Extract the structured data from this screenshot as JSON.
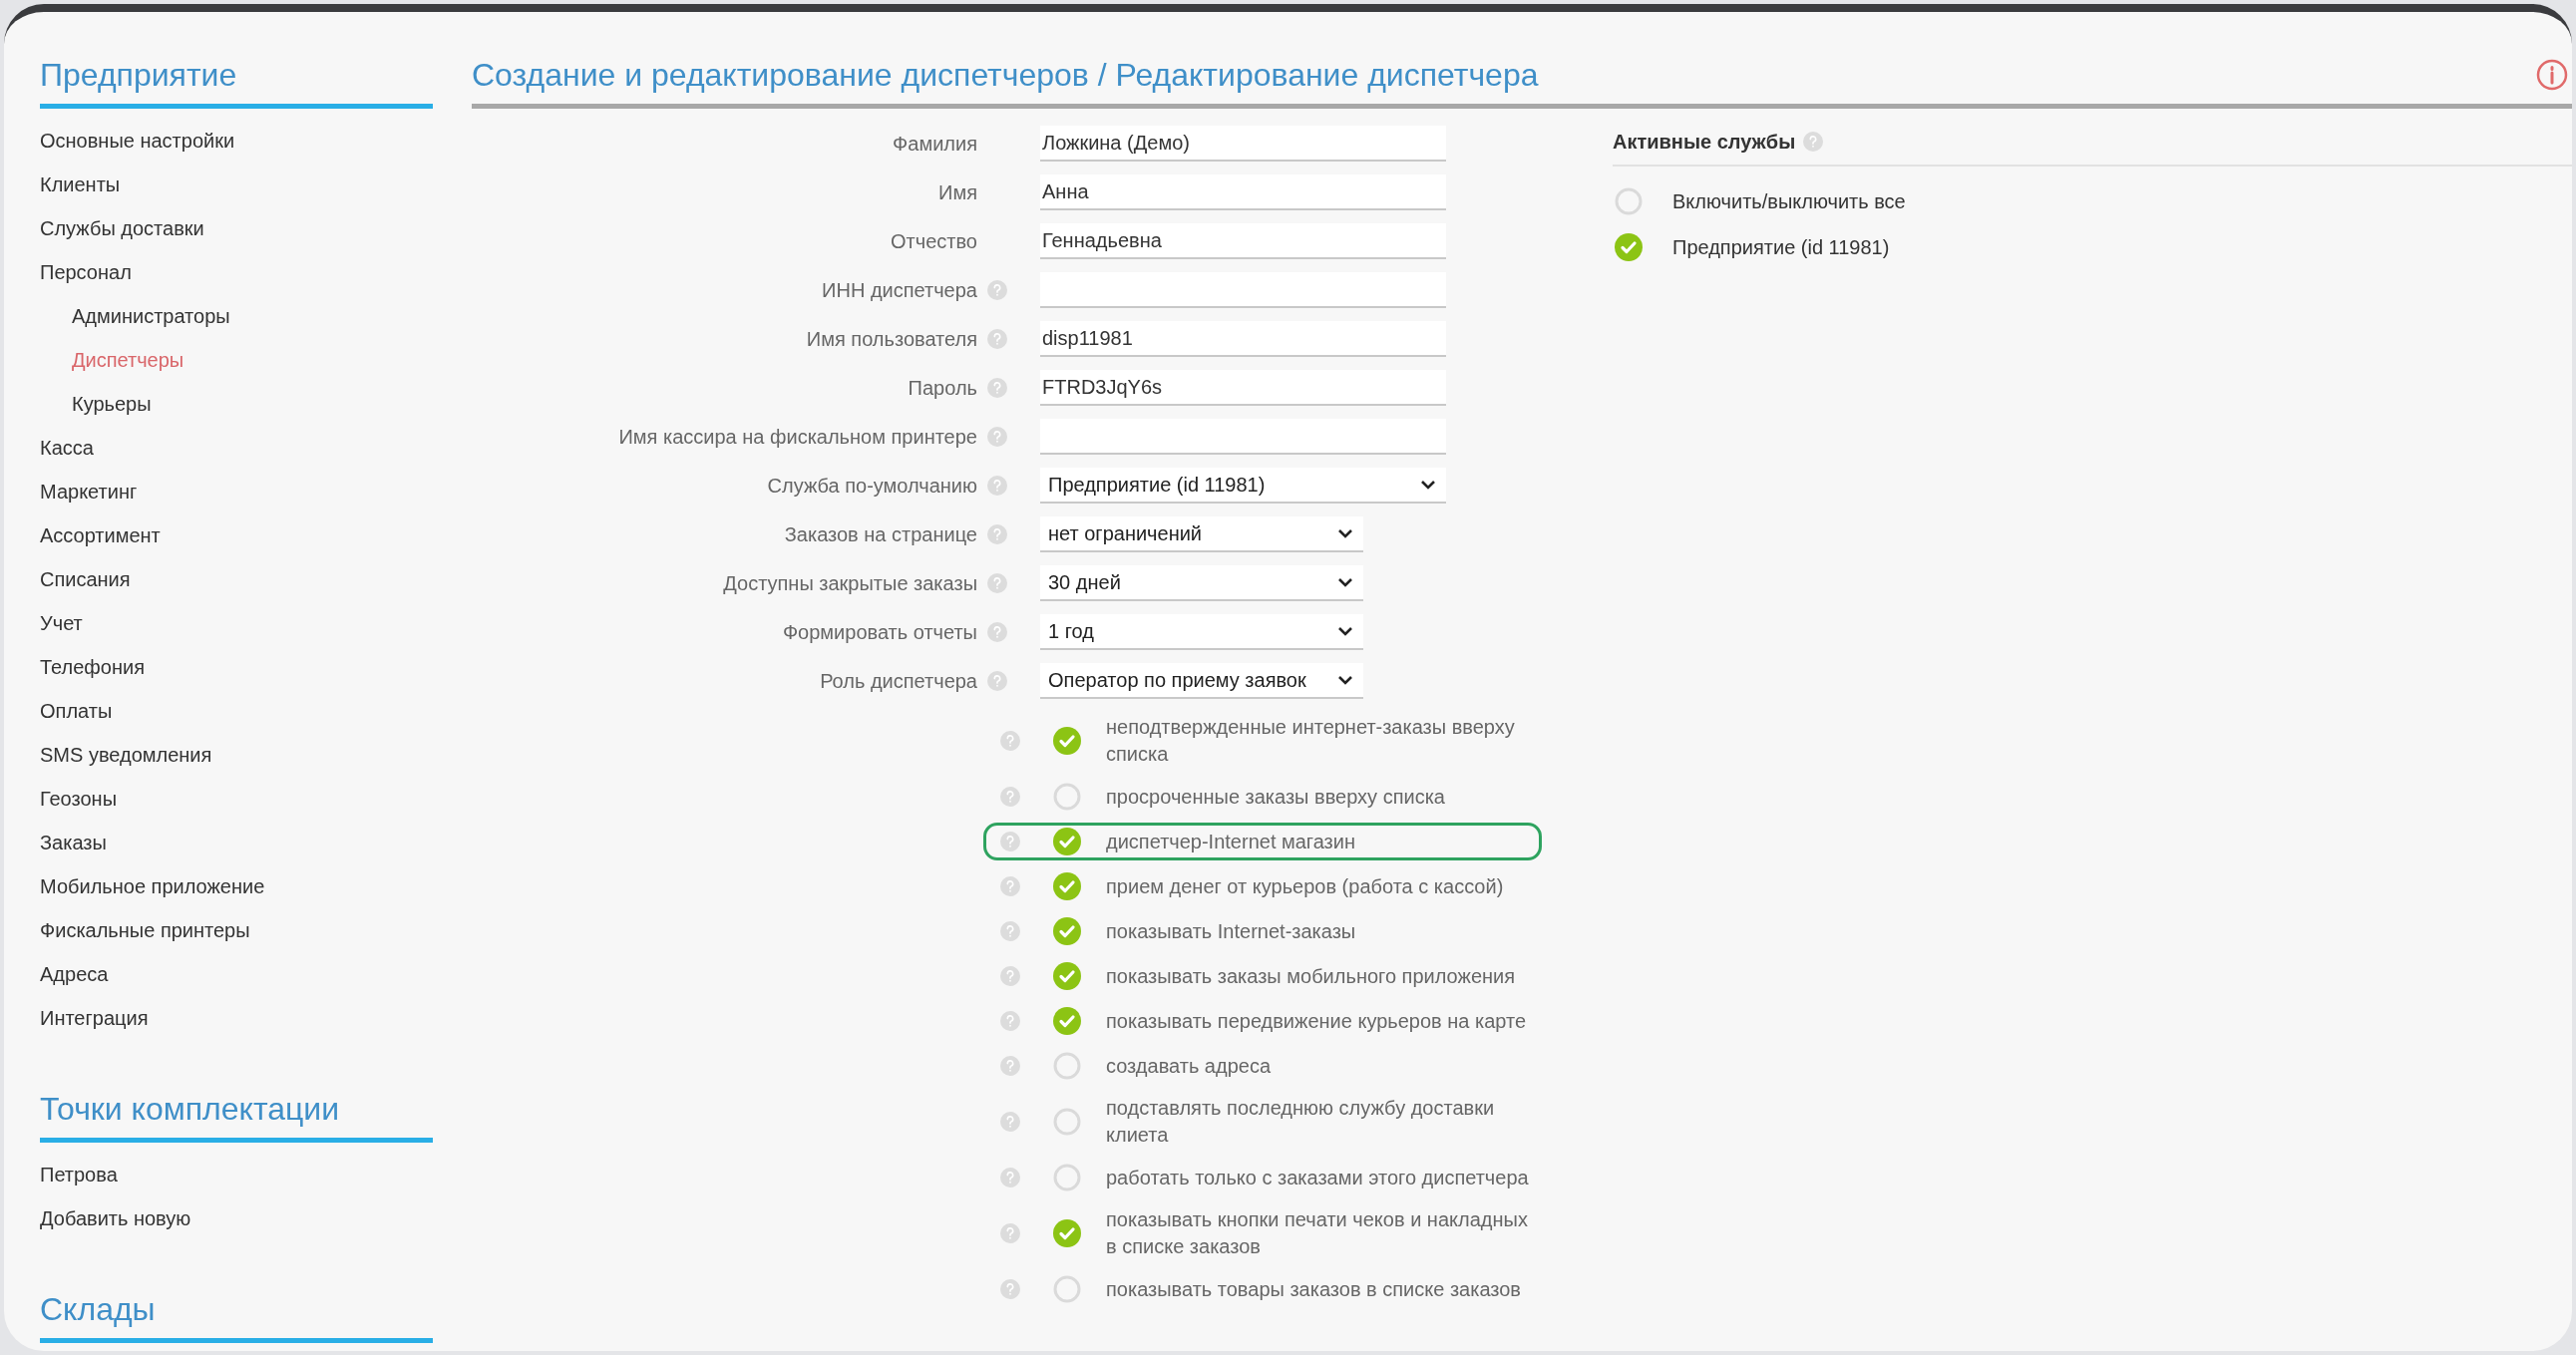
{
  "sidebar": {
    "sections": [
      {
        "title": "Предприятие",
        "items": [
          {
            "label": "Основные настройки",
            "selected": false
          },
          {
            "label": "Клиенты",
            "selected": false
          },
          {
            "label": "Службы доставки",
            "selected": false
          },
          {
            "label": "Персонал",
            "selected": false,
            "children": [
              {
                "label": "Администраторы",
                "selected": false
              },
              {
                "label": "Диспетчеры",
                "selected": true
              },
              {
                "label": "Курьеры",
                "selected": false
              }
            ]
          },
          {
            "label": "Касса",
            "selected": false
          },
          {
            "label": "Маркетинг",
            "selected": false
          },
          {
            "label": "Ассортимент",
            "selected": false
          },
          {
            "label": "Списания",
            "selected": false
          },
          {
            "label": "Учет",
            "selected": false
          },
          {
            "label": "Телефония",
            "selected": false
          },
          {
            "label": "Оплаты",
            "selected": false
          },
          {
            "label": "SMS уведомления",
            "selected": false
          },
          {
            "label": "Геозоны",
            "selected": false
          },
          {
            "label": "Заказы",
            "selected": false
          },
          {
            "label": "Мобильное приложение",
            "selected": false
          },
          {
            "label": "Фискальные принтеры",
            "selected": false
          },
          {
            "label": "Адреса",
            "selected": false
          },
          {
            "label": "Интеграция",
            "selected": false
          }
        ]
      },
      {
        "title": "Точки комплектации",
        "items": [
          {
            "label": "Петрова",
            "selected": false
          },
          {
            "label": "Добавить новую",
            "selected": false
          }
        ]
      },
      {
        "title": "Склады"
      }
    ]
  },
  "page_title": "Создание и редактирование диспетчеров / Редактирование диспетчера",
  "form": {
    "fields": [
      {
        "label": "Фамилия",
        "kind": "text",
        "value": "Ложкина (Демо)",
        "help": false
      },
      {
        "label": "Имя",
        "kind": "text",
        "value": "Анна",
        "help": false
      },
      {
        "label": "Отчество",
        "kind": "text",
        "value": "Геннадьевна",
        "help": false
      },
      {
        "label": "ИНН диспетчера",
        "kind": "text",
        "help": true
      },
      {
        "label": "Имя пользователя",
        "kind": "text",
        "value": "disp11981",
        "help": true
      },
      {
        "label": "Пароль",
        "kind": "text",
        "value": "FTRD3JqY6s",
        "help": true
      },
      {
        "label": "Имя кассира на фискальном принтере",
        "kind": "text",
        "help": true
      },
      {
        "label": "Служба по-умолчанию",
        "kind": "select",
        "value": "Предприятие (id 11981)",
        "help": true
      },
      {
        "label": "Заказов на странице",
        "kind": "select",
        "value": "нет ограничений",
        "help": true
      },
      {
        "label": "Доступны закрытые заказы",
        "kind": "select",
        "value": "30 дней",
        "help": true
      },
      {
        "label": "Формировать отчеты",
        "kind": "select",
        "value": "1 год",
        "help": true
      },
      {
        "label": "Роль диспетчера",
        "kind": "select",
        "value": "Оператор по приему заявок",
        "help": true
      }
    ],
    "options": [
      {
        "label": "неподтвержденные интернет-заказы вверху списка",
        "checked": true,
        "highlighted": false
      },
      {
        "label": "просроченные заказы вверху списка",
        "checked": false,
        "highlighted": false
      },
      {
        "label": "диспетчер-Internet магазин",
        "checked": true,
        "highlighted": true
      },
      {
        "label": "прием денег от курьеров (работа с кассой)",
        "checked": true,
        "highlighted": false
      },
      {
        "label": "показывать Internet-заказы",
        "checked": true,
        "highlighted": false
      },
      {
        "label": "показывать заказы мобильного приложения",
        "checked": true,
        "highlighted": false
      },
      {
        "label": "показывать передвижение курьеров на карте",
        "checked": true,
        "highlighted": false
      },
      {
        "label": "создавать адреса",
        "checked": false,
        "highlighted": false
      },
      {
        "label": "подставлять последнюю службу доставки клиета",
        "checked": false,
        "highlighted": false
      },
      {
        "label": "работать только с заказами этого диспетчера",
        "checked": false,
        "highlighted": false
      },
      {
        "label": "показывать кнопки печати чеков и накладных в списке заказов",
        "checked": true,
        "highlighted": false
      },
      {
        "label": "показывать товары заказов в списке заказов",
        "checked": false,
        "highlighted": false
      }
    ]
  },
  "services": {
    "title": "Активные службы",
    "items": [
      {
        "label": "Включить/выключить все",
        "checked": false
      },
      {
        "label": "Предприятие (id 11981)",
        "checked": true
      }
    ]
  }
}
